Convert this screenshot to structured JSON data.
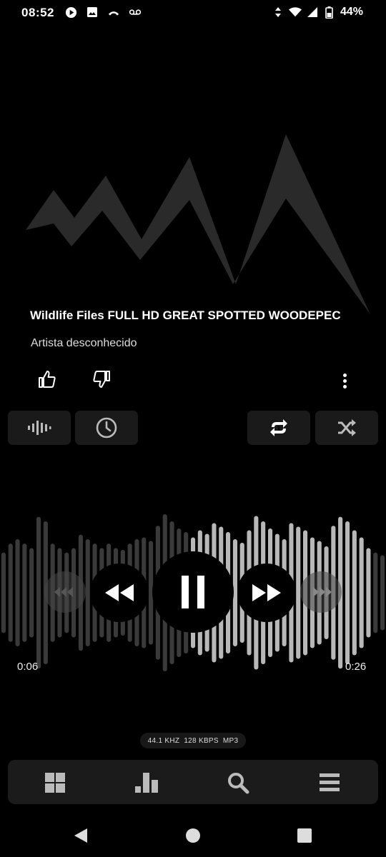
{
  "status_bar": {
    "time": "08:52",
    "battery": "44%",
    "left_icons": [
      "play-circle-icon",
      "image-icon",
      "missed-call-icon",
      "voicemail-icon"
    ],
    "right_icons": [
      "data-arrows-icon",
      "wifi-icon",
      "signal-icon",
      "battery-icon"
    ]
  },
  "track": {
    "title": "Wildlife Files FULL HD GREAT SPOTTED WOODEPEC",
    "artist": "Artista desconhecido"
  },
  "actions": {
    "like_icon": "thumbs-up-icon",
    "dislike_icon": "thumbs-down-icon",
    "more_icon": "more-vertical-icon"
  },
  "toolbar": {
    "left": [
      "equalizer-icon",
      "sleep-timer-icon"
    ],
    "right": [
      "repeat-one-icon",
      "shuffle-icon"
    ]
  },
  "player": {
    "current_time": "0:06",
    "total_time": "0:26",
    "progress": 0.23,
    "state": "playing"
  },
  "format": {
    "sample_rate": "44.1 KHZ",
    "bitrate": "128 KBPS",
    "codec": "MP3"
  },
  "bottom_nav": [
    "library-grid-icon",
    "charts-icon",
    "search-icon",
    "queue-list-icon"
  ],
  "system_nav": [
    "back-icon",
    "home-icon",
    "recents-icon"
  ],
  "colors": {
    "background": "#000000",
    "surface": "#1a1a1a",
    "waveform_played": "#b8b8b8",
    "waveform_unplayed": "#3a3a3a",
    "artwork": "#2a2a2a"
  }
}
